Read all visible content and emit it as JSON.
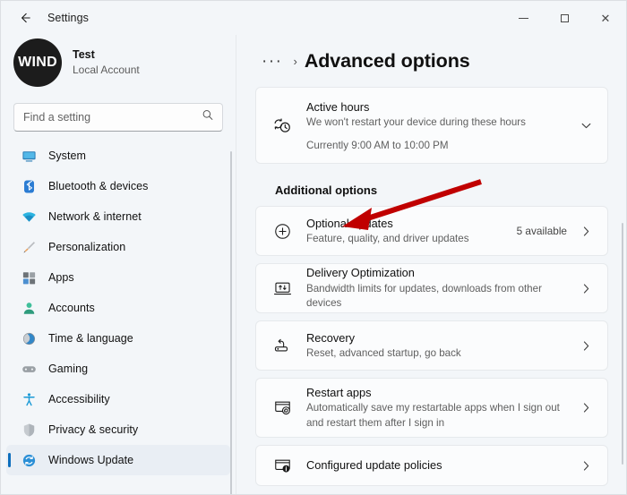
{
  "window": {
    "titlebar": {
      "back_label": "back-arrow",
      "title": "Settings",
      "minimize": "minimize",
      "maximize": "maximize",
      "close": "close"
    }
  },
  "sidebar": {
    "account": {
      "avatar_initials": "WIND",
      "name": "Test",
      "subtitle": "Local Account"
    },
    "search": {
      "placeholder": "Find a setting",
      "value": "",
      "icon": "search-icon"
    },
    "items": [
      {
        "label": "System",
        "icon": "monitor-icon",
        "selected": false
      },
      {
        "label": "Bluetooth & devices",
        "icon": "bluetooth-icon",
        "selected": false
      },
      {
        "label": "Network & internet",
        "icon": "wifi-icon",
        "selected": false
      },
      {
        "label": "Personalization",
        "icon": "brush-icon",
        "selected": false
      },
      {
        "label": "Apps",
        "icon": "apps-icon",
        "selected": false
      },
      {
        "label": "Accounts",
        "icon": "person-icon",
        "selected": false
      },
      {
        "label": "Time & language",
        "icon": "globe-clock-icon",
        "selected": false
      },
      {
        "label": "Gaming",
        "icon": "gamepad-icon",
        "selected": false
      },
      {
        "label": "Accessibility",
        "icon": "accessibility-icon",
        "selected": false
      },
      {
        "label": "Privacy & security",
        "icon": "shield-icon",
        "selected": false
      },
      {
        "label": "Windows Update",
        "icon": "update-icon",
        "selected": true
      }
    ]
  },
  "main": {
    "breadcrumb": {
      "overflow": "···",
      "separator": "›"
    },
    "title": "Advanced options",
    "active_hours": {
      "title": "Active hours",
      "subtitle": "We won't restart your device during these hours",
      "detail": "Currently 9:00 AM to 10:00 PM",
      "icon": "active-hours-icon",
      "expand_icon": "chevron-down-icon"
    },
    "section_title": "Additional options",
    "options": [
      {
        "title": "Optional updates",
        "subtitle": "Feature, quality, and driver updates",
        "badge": "5 available",
        "icon": "plus-circle-icon"
      },
      {
        "title": "Delivery Optimization",
        "subtitle": "Bandwidth limits for updates, downloads from other devices",
        "badge": "",
        "icon": "delivery-optimization-icon"
      },
      {
        "title": "Recovery",
        "subtitle": "Reset, advanced startup, go back",
        "badge": "",
        "icon": "recovery-icon"
      },
      {
        "title": "Restart apps",
        "subtitle": "Automatically save my restartable apps when I sign out and restart them after I sign in",
        "badge": "",
        "icon": "restart-apps-icon"
      },
      {
        "title": "Configured update policies",
        "subtitle": "",
        "badge": "",
        "icon": "update-policies-icon"
      }
    ]
  },
  "annotation": {
    "type": "arrow",
    "color": "#c00000",
    "points_to": "optional-updates-card"
  },
  "colors": {
    "accent": "#0d6ebd",
    "window_bg": "#f3f6f9",
    "card_bg": "#fbfcfd",
    "annotation_red": "#c00000"
  }
}
